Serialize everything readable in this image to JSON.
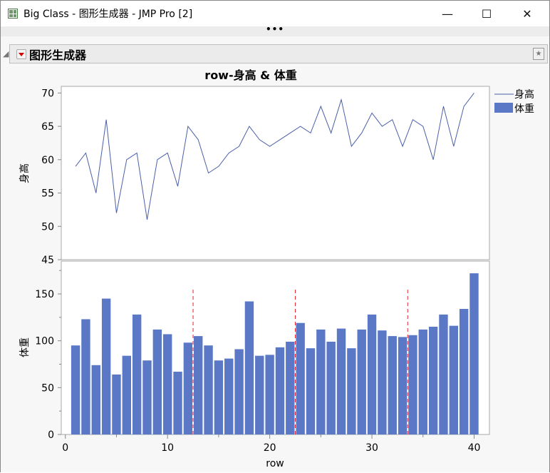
{
  "window": {
    "title": "Big Class - 图形生成器 - JMP Pro [2]",
    "minimize": "—",
    "maximize": "☐",
    "close": "✕",
    "more": "•••"
  },
  "outline": {
    "title": "图形生成器"
  },
  "chart_data": {
    "type": "line+bar",
    "title": "row-身高 & 体重",
    "xlabel": "row",
    "xlim": [
      -0.4,
      41.5
    ],
    "xticks": [
      "0",
      "10",
      "20",
      "30",
      "40"
    ],
    "x": [
      1,
      2,
      3,
      4,
      5,
      6,
      7,
      8,
      9,
      10,
      11,
      12,
      13,
      14,
      15,
      16,
      17,
      18,
      19,
      20,
      21,
      22,
      23,
      24,
      25,
      26,
      27,
      28,
      29,
      30,
      31,
      32,
      33,
      34,
      35,
      36,
      37,
      38,
      39,
      40
    ],
    "series": [
      {
        "name": "身高",
        "type": "line",
        "color": "#4a5fa8",
        "ylabel": "身高",
        "ylim": [
          45,
          71
        ],
        "yticks": [
          "45",
          "50",
          "55",
          "60",
          "65",
          "70"
        ],
        "values": [
          59,
          61,
          55,
          66,
          52,
          60,
          61,
          51,
          60,
          61,
          56,
          65,
          63,
          58,
          59,
          61,
          62,
          65,
          63,
          62,
          63,
          64,
          65,
          64,
          68,
          64,
          69,
          62,
          64,
          67,
          65,
          66,
          62,
          66,
          65,
          60,
          68,
          62,
          68,
          70
        ]
      },
      {
        "name": "体重",
        "type": "bar",
        "color": "#5b78c7",
        "ylabel": "体重",
        "ylim": [
          0,
          185
        ],
        "yticks": [
          "0",
          "50",
          "100",
          "150"
        ],
        "values": [
          95,
          123,
          74,
          145,
          64,
          84,
          128,
          79,
          112,
          107,
          67,
          98,
          105,
          95,
          79,
          81,
          91,
          142,
          84,
          85,
          93,
          99,
          119,
          92,
          112,
          99,
          113,
          92,
          112,
          128,
          111,
          105,
          104,
          106,
          112,
          115,
          128,
          116,
          134,
          172
        ]
      }
    ],
    "reference_lines_x": [
      12.5,
      22.5,
      33.5
    ],
    "reference_line_color": "#e8202a",
    "legend": "right"
  }
}
